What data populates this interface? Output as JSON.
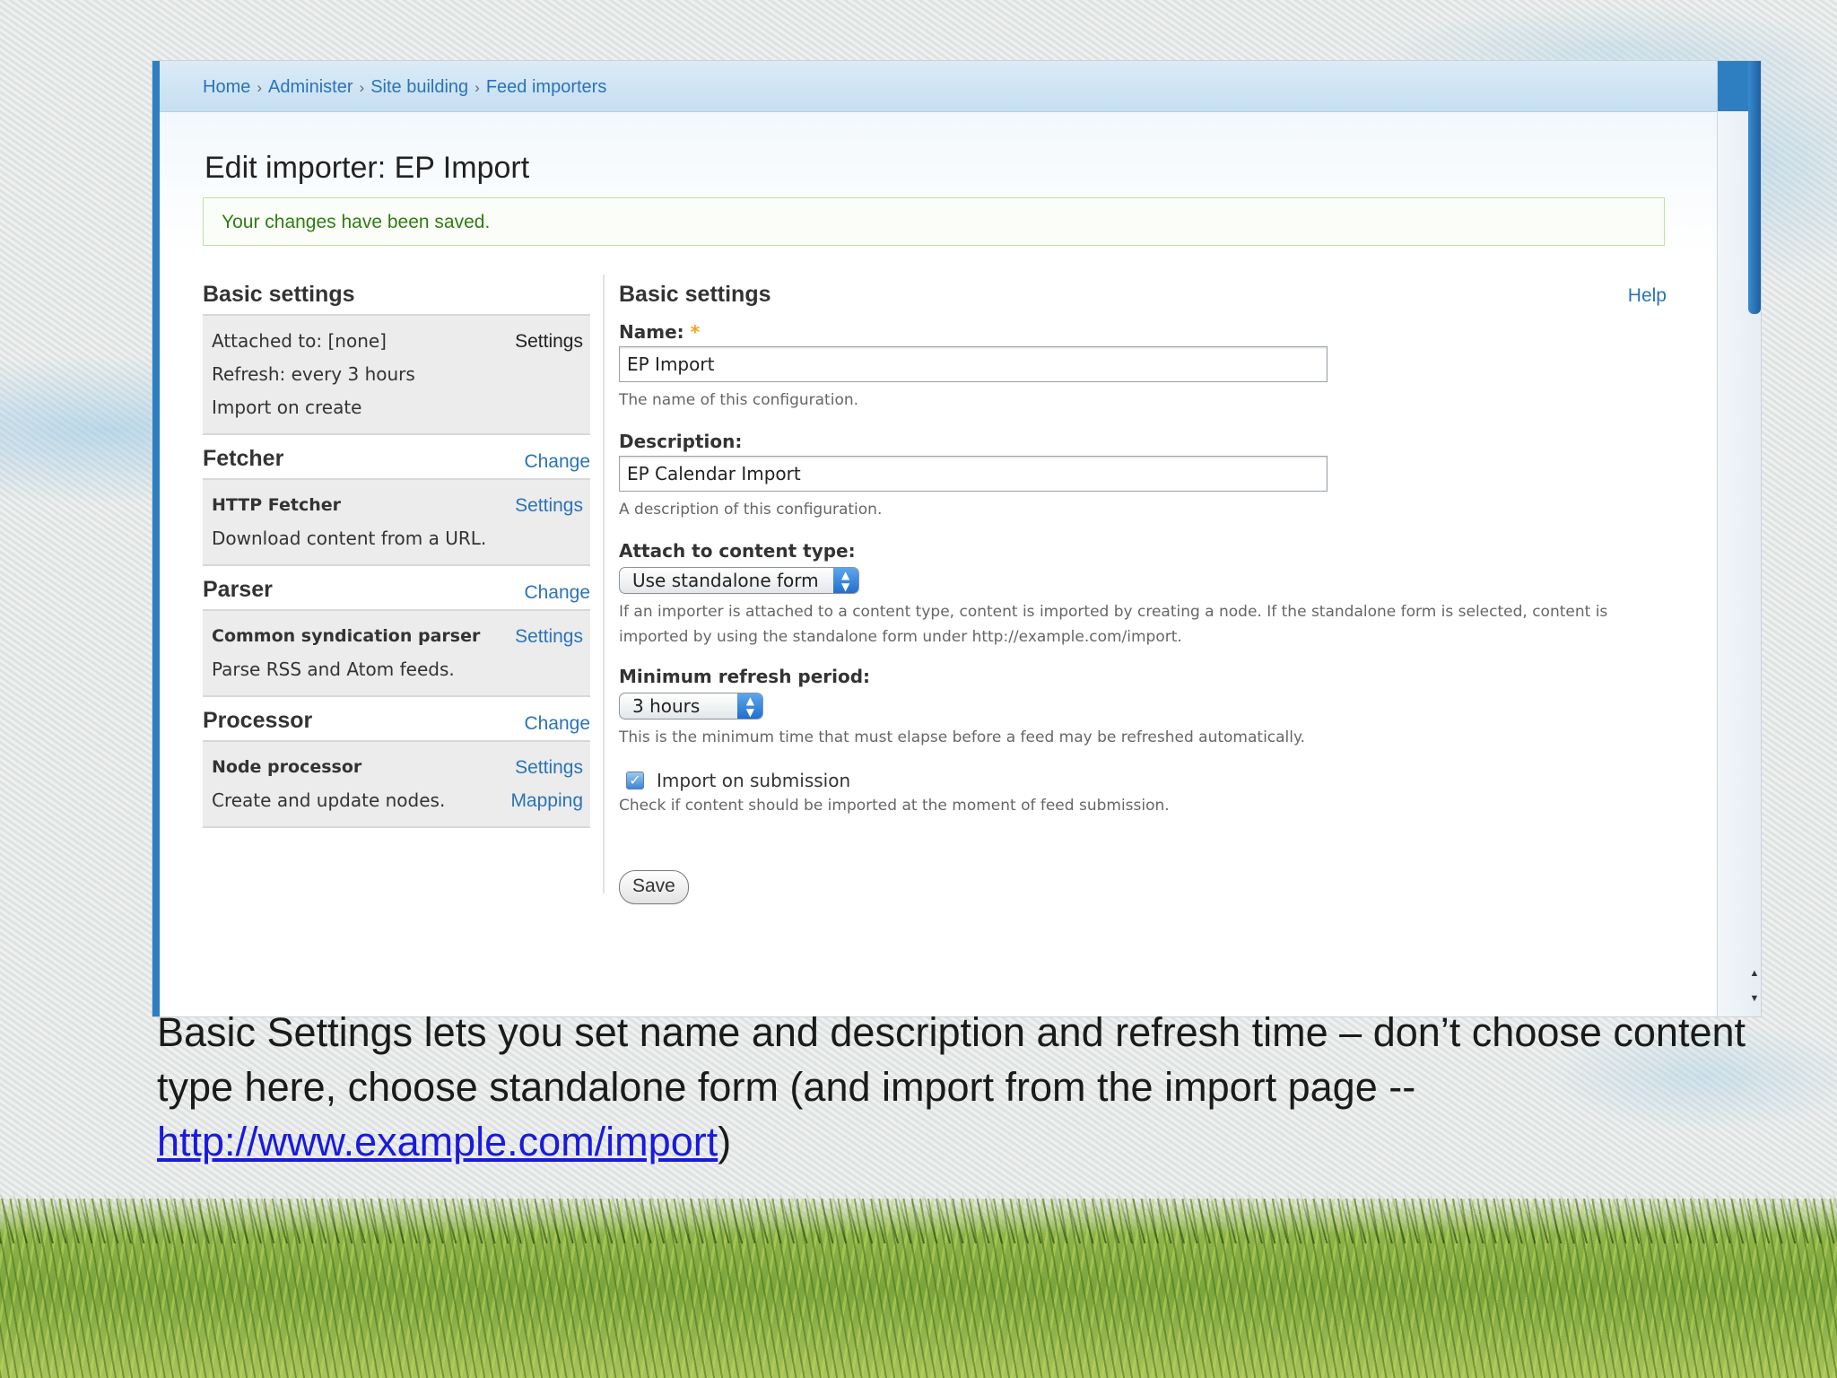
{
  "breadcrumb": [
    "Home",
    "Administer",
    "Site building",
    "Feed importers"
  ],
  "page_title": "Edit importer: EP Import",
  "status_message": "Your changes have been saved.",
  "left_column": {
    "basic_settings": {
      "heading": "Basic settings",
      "lines": [
        "Attached to: [none]",
        "Refresh: every 3 hours",
        "Import on create"
      ],
      "settings_label": "Settings"
    },
    "fetcher": {
      "heading": "Fetcher",
      "change_label": "Change",
      "name": "HTTP Fetcher",
      "description": "Download content from a URL.",
      "settings_label": "Settings"
    },
    "parser": {
      "heading": "Parser",
      "change_label": "Change",
      "name": "Common syndication parser",
      "description": "Parse RSS and Atom feeds.",
      "settings_label": "Settings"
    },
    "processor": {
      "heading": "Processor",
      "change_label": "Change",
      "name": "Node processor",
      "description": "Create and update nodes.",
      "settings_label": "Settings",
      "mapping_label": "Mapping"
    }
  },
  "form": {
    "heading": "Basic settings",
    "help_label": "Help",
    "name": {
      "label": "Name:",
      "required_mark": "*",
      "value": "EP Import",
      "description": "The name of this configuration."
    },
    "description": {
      "label": "Description:",
      "value": "EP Calendar Import",
      "description": "A description of this configuration."
    },
    "attach": {
      "label": "Attach to content type:",
      "selected": "Use standalone form",
      "description": "If an importer is attached to a content type, content is imported by creating a node. If the standalone form is selected, content is imported by using the standalone form under http://example.com/import."
    },
    "refresh": {
      "label": "Minimum refresh period:",
      "selected": "3 hours",
      "description": "This is the minimum time that must elapse before a feed may be refreshed automatically."
    },
    "import_on_submission": {
      "label": "Import on submission",
      "checked": true,
      "description": "Check if content should be imported at the moment of feed submission."
    },
    "save_label": "Save"
  },
  "caption": {
    "text": "Basic Settings lets you set name and description and refresh time – don’t choose content type here, choose standalone form (and import from the import page -- ",
    "link": "http://www.example.com/import",
    "tail": ")"
  },
  "colors": {
    "link": "#2a73b9",
    "accent_blue": "#2d7fc2",
    "status_green": "#2e7d12",
    "required": "#f3a21b"
  }
}
